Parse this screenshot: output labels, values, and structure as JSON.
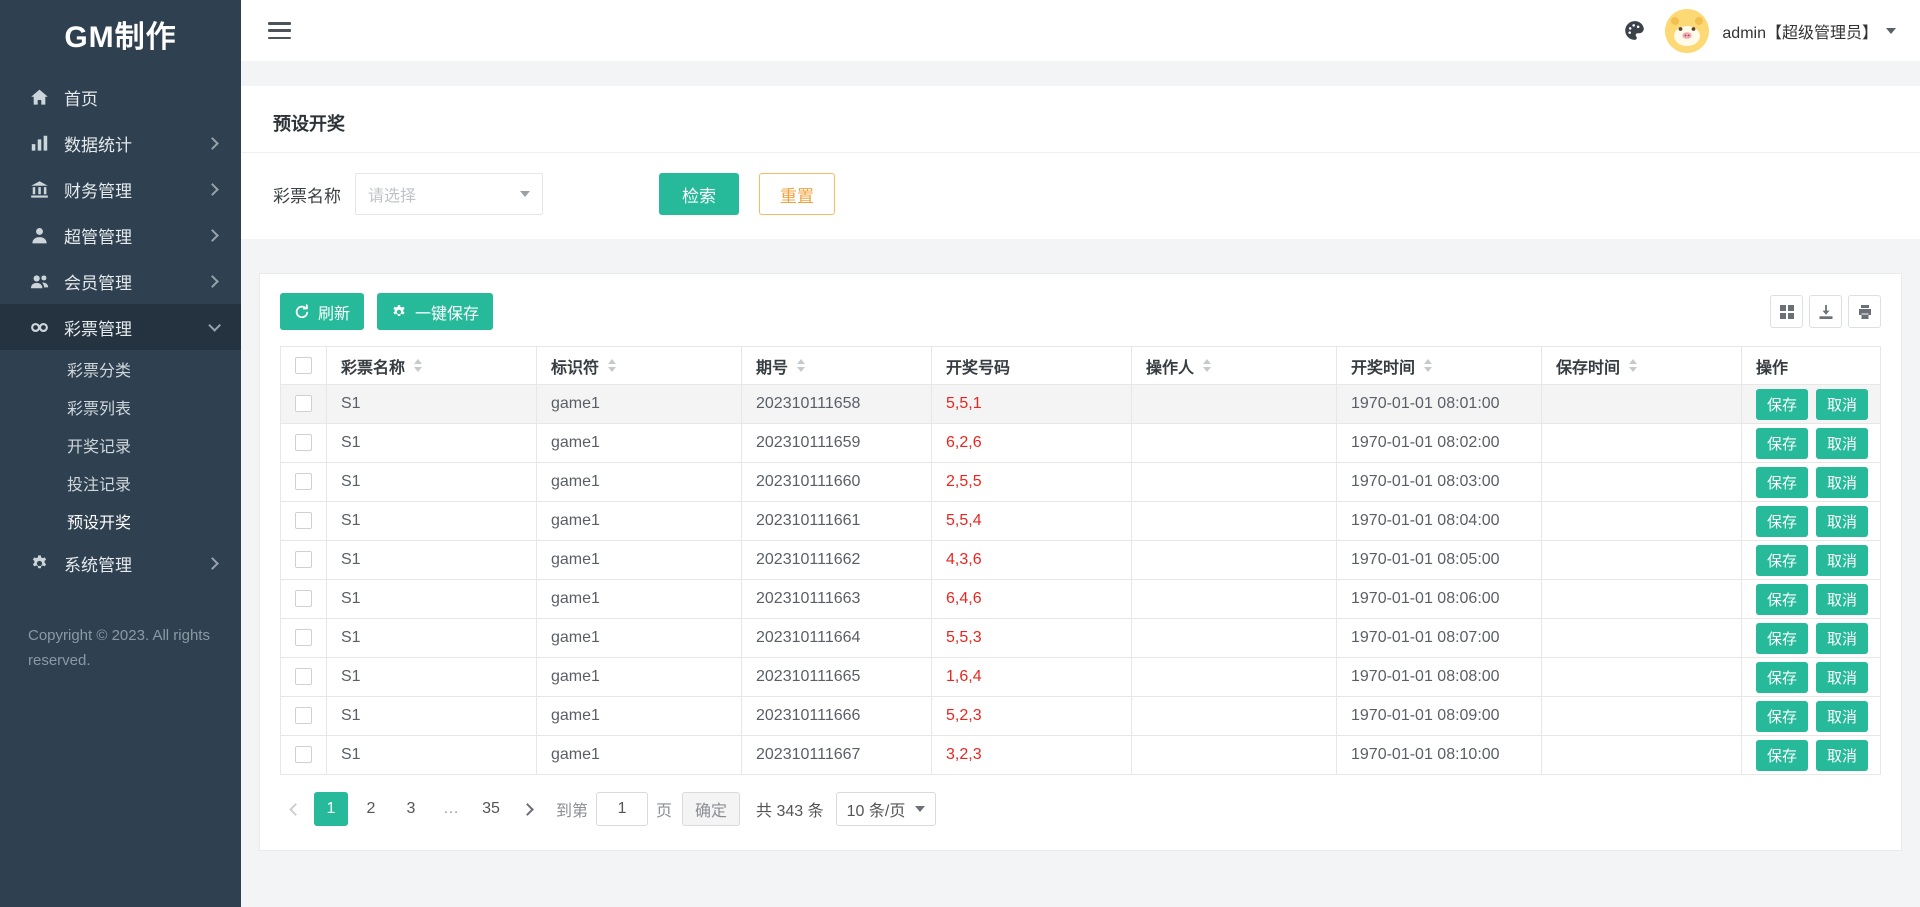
{
  "colors": {
    "accent": "#26b99a",
    "warning": "#f8ac59",
    "number_red": "#e8261f",
    "sidebar_bg": "#2f4050"
  },
  "app": {
    "logo_text": "GM制作"
  },
  "topbar": {
    "username": "admin【超级管理员】"
  },
  "sidebar": {
    "menu": [
      {
        "label": "首页",
        "icon": "home",
        "has_children": false
      },
      {
        "label": "数据统计",
        "icon": "chart",
        "has_children": true
      },
      {
        "label": "财务管理",
        "icon": "bank",
        "has_children": true
      },
      {
        "label": "超管管理",
        "icon": "admin",
        "has_children": true
      },
      {
        "label": "会员管理",
        "icon": "users",
        "has_children": true
      },
      {
        "label": "彩票管理",
        "icon": "lottery",
        "has_children": true,
        "expanded": true,
        "children": [
          {
            "label": "彩票分类",
            "active": false
          },
          {
            "label": "彩票列表",
            "active": false
          },
          {
            "label": "开奖记录",
            "active": false
          },
          {
            "label": "投注记录",
            "active": false
          },
          {
            "label": "预设开奖",
            "active": true
          }
        ]
      },
      {
        "label": "系统管理",
        "icon": "gear",
        "has_children": true
      }
    ],
    "copyright": "Copyright © 2023. All rights reserved."
  },
  "page": {
    "title": "预设开奖"
  },
  "filters": {
    "name_label": "彩票名称",
    "select_placeholder": "请选择",
    "search_button": "检索",
    "reset_button": "重置"
  },
  "toolbar": {
    "refresh_button": "刷新",
    "save_all_button": "一键保存"
  },
  "table": {
    "headers": [
      {
        "label": "彩票名称",
        "sortable": true
      },
      {
        "label": "标识符",
        "sortable": true
      },
      {
        "label": "期号",
        "sortable": true
      },
      {
        "label": "开奖号码",
        "sortable": false
      },
      {
        "label": "操作人",
        "sortable": true
      },
      {
        "label": "开奖时间",
        "sortable": true
      },
      {
        "label": "保存时间",
        "sortable": true
      },
      {
        "label": "操作",
        "sortable": false
      }
    ],
    "save_label": "保存",
    "cancel_label": "取消",
    "rows": [
      {
        "name": "S1",
        "identifier": "game1",
        "issue": "202310111658",
        "numbers": "5,5,1",
        "operator": "",
        "draw_time": "1970-01-01 08:01:00",
        "save_time": ""
      },
      {
        "name": "S1",
        "identifier": "game1",
        "issue": "202310111659",
        "numbers": "6,2,6",
        "operator": "",
        "draw_time": "1970-01-01 08:02:00",
        "save_time": ""
      },
      {
        "name": "S1",
        "identifier": "game1",
        "issue": "202310111660",
        "numbers": "2,5,5",
        "operator": "",
        "draw_time": "1970-01-01 08:03:00",
        "save_time": ""
      },
      {
        "name": "S1",
        "identifier": "game1",
        "issue": "202310111661",
        "numbers": "5,5,4",
        "operator": "",
        "draw_time": "1970-01-01 08:04:00",
        "save_time": ""
      },
      {
        "name": "S1",
        "identifier": "game1",
        "issue": "202310111662",
        "numbers": "4,3,6",
        "operator": "",
        "draw_time": "1970-01-01 08:05:00",
        "save_time": ""
      },
      {
        "name": "S1",
        "identifier": "game1",
        "issue": "202310111663",
        "numbers": "6,4,6",
        "operator": "",
        "draw_time": "1970-01-01 08:06:00",
        "save_time": ""
      },
      {
        "name": "S1",
        "identifier": "game1",
        "issue": "202310111664",
        "numbers": "5,5,3",
        "operator": "",
        "draw_time": "1970-01-01 08:07:00",
        "save_time": ""
      },
      {
        "name": "S1",
        "identifier": "game1",
        "issue": "202310111665",
        "numbers": "1,6,4",
        "operator": "",
        "draw_time": "1970-01-01 08:08:00",
        "save_time": ""
      },
      {
        "name": "S1",
        "identifier": "game1",
        "issue": "202310111666",
        "numbers": "5,2,3",
        "operator": "",
        "draw_time": "1970-01-01 08:09:00",
        "save_time": ""
      },
      {
        "name": "S1",
        "identifier": "game1",
        "issue": "202310111667",
        "numbers": "3,2,3",
        "operator": "",
        "draw_time": "1970-01-01 08:10:00",
        "save_time": ""
      }
    ]
  },
  "pagination": {
    "pages": [
      "1",
      "2",
      "3",
      "…",
      "35"
    ],
    "active_page": "1",
    "jump_prefix": "到第",
    "jump_value": "1",
    "jump_suffix": "页",
    "confirm_button": "确定",
    "total_text": "共 343 条",
    "page_size_text": "10 条/页"
  }
}
